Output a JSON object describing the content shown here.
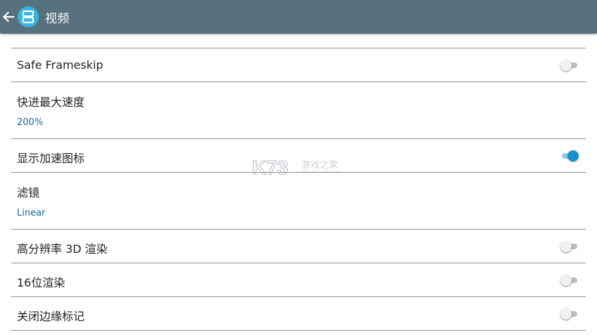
{
  "toolbar": {
    "title": "视频",
    "back_icon": "arrow-left-icon",
    "app_icon": "ds-emulator-logo-icon",
    "bar_color": "#56707d",
    "app_icon_color": "#36b5e0"
  },
  "settings": [
    {
      "title": "Safe Frameskip",
      "type": "switch",
      "checked": false
    },
    {
      "title": "快进最大速度",
      "type": "value",
      "value": "200%"
    },
    {
      "title": "显示加速图标",
      "type": "switch",
      "checked": true
    },
    {
      "title": "滤镜",
      "type": "value",
      "value": "Linear"
    },
    {
      "title": "高分辨率 3D 渲染",
      "type": "switch",
      "checked": false
    },
    {
      "title": "16位渲染",
      "type": "switch",
      "checked": false
    },
    {
      "title": "关闭边缘标记",
      "type": "switch",
      "checked": false
    }
  ],
  "colors": {
    "accent": "#1a8fcf",
    "value_text": "#12679b",
    "divider": "#8f8f8f"
  },
  "watermark": {
    "logo_text": "K73",
    "caption": "游戏之家"
  }
}
